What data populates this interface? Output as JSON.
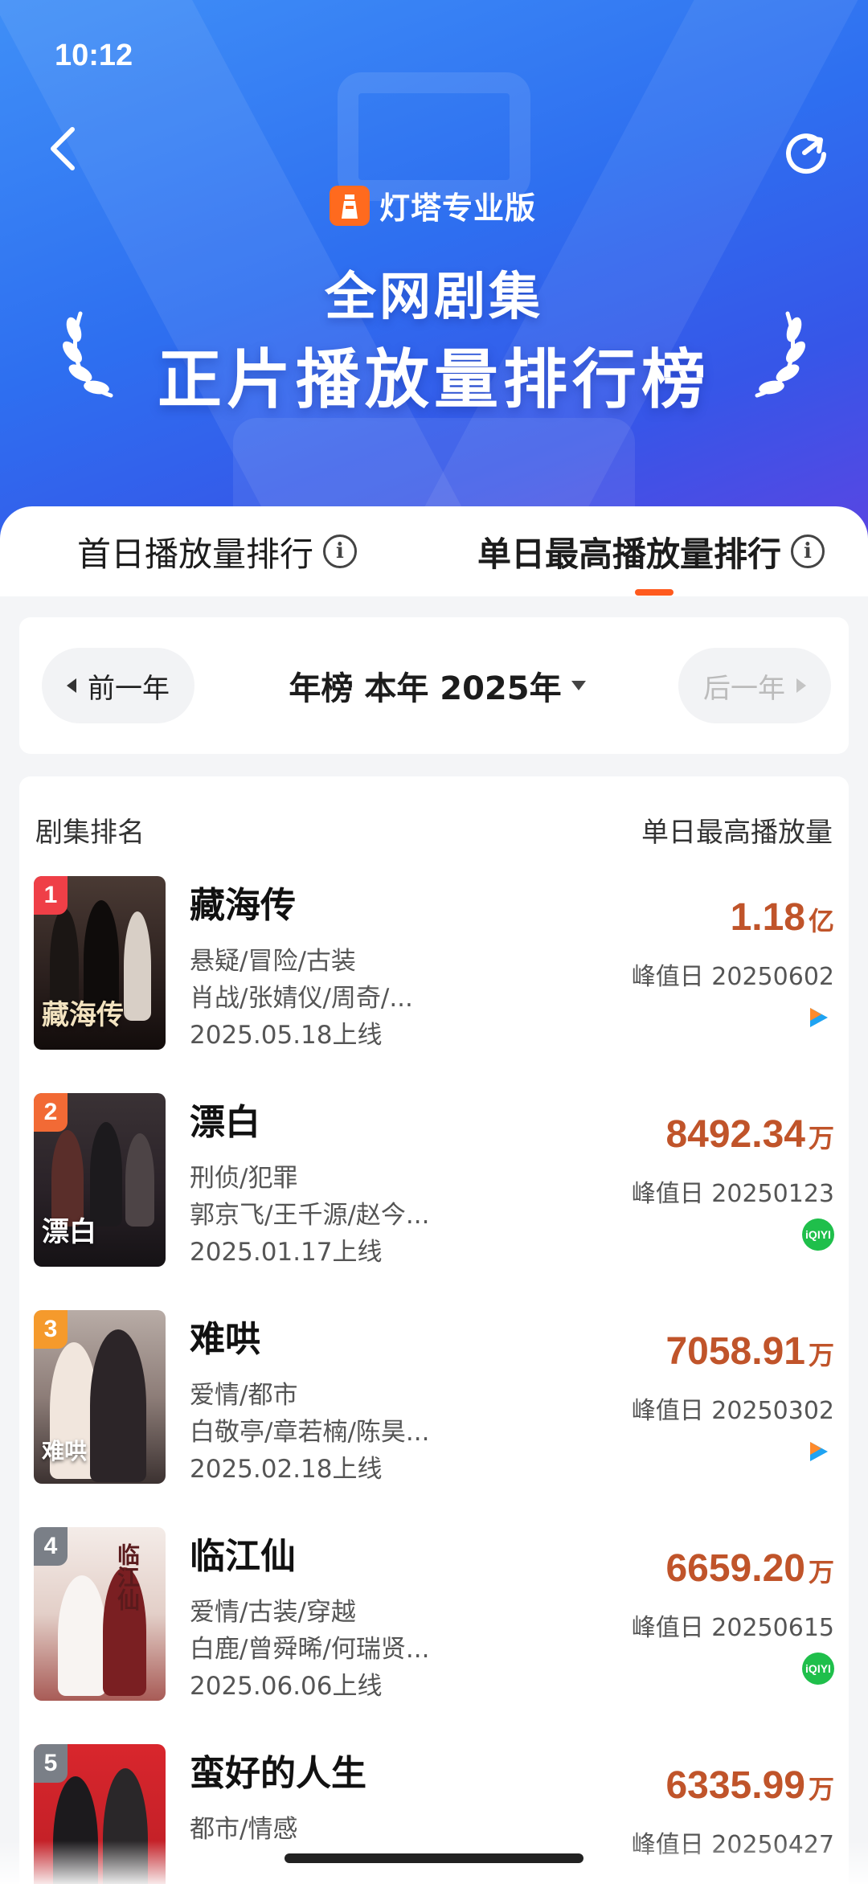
{
  "status_bar": {
    "time": "10:12"
  },
  "header": {
    "brand": "灯塔专业版",
    "title_line1": "全网剧集",
    "title_line2": "正片播放量排行榜"
  },
  "tabs": [
    {
      "label": "首日播放量排行",
      "active": false
    },
    {
      "label": "单日最高播放量排行",
      "active": true
    }
  ],
  "year_selector": {
    "prev": "前一年",
    "current": "年榜 本年 2025年",
    "next": "后一年"
  },
  "list": {
    "col_left": "剧集排名",
    "col_right": "单日最高播放量",
    "items": [
      {
        "rank": "1",
        "title": "藏海传",
        "genres": "悬疑/冒险/古装",
        "cast": "肖战/张婧仪/周奇/...",
        "release": "2025.05.18上线",
        "value": "1.18",
        "unit": "亿",
        "peak": "峰值日 20250602",
        "platform": "youku",
        "poster_text": "藏海传"
      },
      {
        "rank": "2",
        "title": "漂白",
        "genres": "刑侦/犯罪",
        "cast": "郭京飞/王千源/赵今...",
        "release": "2025.01.17上线",
        "value": "8492.34",
        "unit": "万",
        "peak": "峰值日 20250123",
        "platform": "iqiyi",
        "poster_text": "漂白"
      },
      {
        "rank": "3",
        "title": "难哄",
        "genres": "爱情/都市",
        "cast": "白敬亭/章若楠/陈昊...",
        "release": "2025.02.18上线",
        "value": "7058.91",
        "unit": "万",
        "peak": "峰值日 20250302",
        "platform": "youku",
        "poster_text": "难哄"
      },
      {
        "rank": "4",
        "title": "临江仙",
        "genres": "爱情/古装/穿越",
        "cast": "白鹿/曾舜晞/何瑞贤...",
        "release": "2025.06.06上线",
        "value": "6659.20",
        "unit": "万",
        "peak": "峰值日 20250615",
        "platform": "iqiyi",
        "poster_text": "临江仙"
      },
      {
        "rank": "5",
        "title": "蛮好的人生",
        "genres": "都市/情感",
        "cast": "",
        "release": "",
        "value": "6335.99",
        "unit": "万",
        "peak": "峰值日 20250427",
        "platform": "",
        "poster_text": ""
      }
    ]
  },
  "platform_labels": {
    "iqiyi": "iQIYI"
  },
  "colors": {
    "accent": "#ff5a1e",
    "value": "#c0542a",
    "header_blue": "#2e6ff0"
  }
}
